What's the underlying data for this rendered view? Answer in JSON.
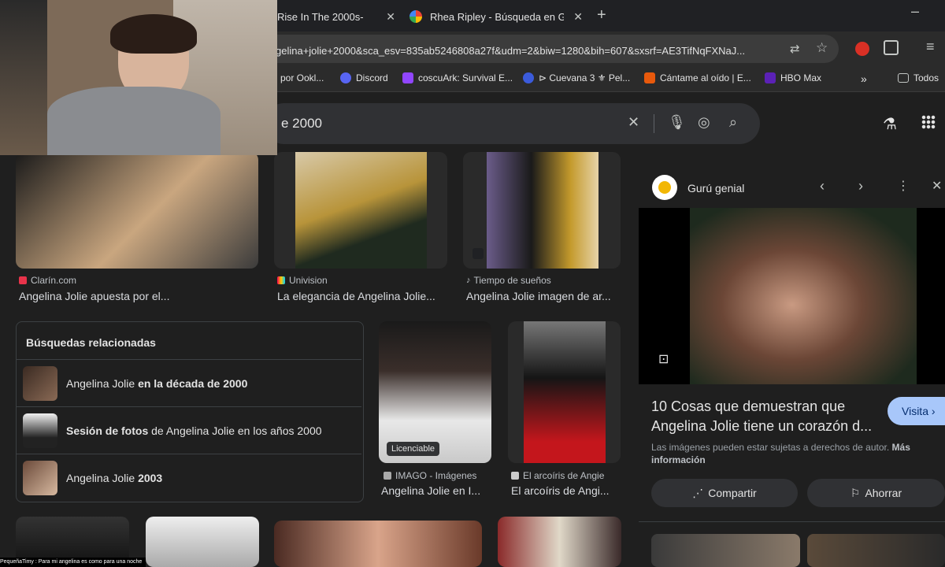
{
  "browser": {
    "tabs": [
      {
        "title": "Rise In The 2000s-"
      },
      {
        "title": "Rhea Ripley - Búsqueda en Goo"
      }
    ],
    "url": "gelina+jolie+2000&sca_esv=835ab5246808a27f&udm=2&biw=1280&bih=607&sxsrf=AE3TifNqFXNaJ...",
    "bookmarks": [
      {
        "label": "por Ookl..."
      },
      {
        "label": "Discord"
      },
      {
        "label": "coscuArk: Survival E..."
      },
      {
        "label": "⊳ Cuevana 3 ⚜ Pel..."
      },
      {
        "label": "Cántame al oído | E..."
      },
      {
        "label": "HBO Max"
      },
      {
        "label": "Todos"
      }
    ]
  },
  "search": {
    "query_visible": "e 2000"
  },
  "results_row1": [
    {
      "source": "Clarín.com",
      "title": "Angelina Jolie apuesta por el..."
    },
    {
      "source": "Univision",
      "title": "La elegancia de Angelina Jolie..."
    },
    {
      "source": "Tiempo de sueños",
      "title": "Angelina Jolie imagen de ar..."
    }
  ],
  "related": {
    "heading": "Búsquedas relacionadas",
    "items": [
      {
        "pre": "Angelina Jolie ",
        "bold": "en la década de 2000",
        "post": ""
      },
      {
        "pre": "",
        "bold": "Sesión de fotos",
        "post": " de Angelina Jolie en los años 2000"
      },
      {
        "pre": "Angelina Jolie ",
        "bold": "2003",
        "post": ""
      }
    ]
  },
  "results_row2": [
    {
      "badge": "Licenciable",
      "source": "IMAGO - Imágenes",
      "title": "Angelina Jolie en I..."
    },
    {
      "source": "El arcoíris de Angie",
      "title": "El arcoíris de Angi..."
    }
  ],
  "panel": {
    "site": "Gurú genial",
    "title_line1": "10 Cosas que demuestran que",
    "title_line2": "Angelina Jolie tiene un corazón d...",
    "visit": "Visita",
    "notice": "Las imágenes pueden estar sujetas a derechos de autor.",
    "more": "Más información",
    "share": "Compartir",
    "save": "Ahorrar"
  },
  "webcam": {
    "overlay_text": "PequeñaTimy : Para mi angelina es como para una noche"
  },
  "colors": {
    "accent_visit": "#a8c7fa",
    "background": "#1f1f1f"
  }
}
